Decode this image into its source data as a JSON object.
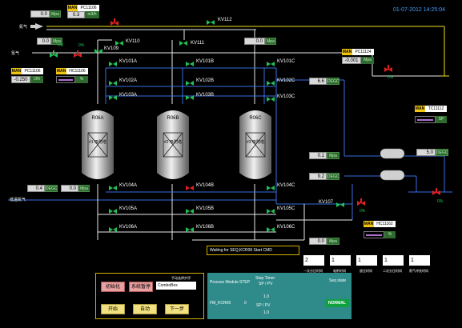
{
  "header": {
    "datetime": "01-07-2012 14:25:04",
    "top_label": "KV112"
  },
  "left_inputs": {
    "n2_label": "氮气",
    "h2_label": "氢气",
    "lowtemp_gas_label": "低温氮气",
    "top_value": "0.0",
    "top_unit": "Mpa",
    "flow_value": "0.0",
    "flow_unit": "Mpa",
    "small_pct": "0%",
    "green_pct": "0%",
    "lowtemp_value": "0.4",
    "lowtemp_unit": "DEGC",
    "lowtemp_value2": "0.0",
    "lowtemp_unit2": "Mpa"
  },
  "pc11106": {
    "mode": "MAN",
    "tag": "PC11106",
    "value": "0.3",
    "unit": "m3/h"
  },
  "hc11106": {
    "mode": "MAN",
    "tag": "PC11106",
    "pv": "-0.250",
    "unit": "ON",
    "tag2": "HC11106",
    "pct": "%"
  },
  "pc11124": {
    "mode": "MAN",
    "tag": "PC11124",
    "pv": "-0.001",
    "unit": "Mpa",
    "pct": "0%"
  },
  "tc11112": {
    "mode": "MAN",
    "tag": "TC11112",
    "sp": "SP"
  },
  "hc11162": {
    "mode": "MAN",
    "tag": "HC11162",
    "pct": "%"
  },
  "valves": {
    "kv110": "KV110",
    "kv109": "KV109",
    "kv111": "KV111",
    "kv101a": "KV101A",
    "kv102a": "KV102A",
    "kv103a": "KV103A",
    "kv101b": "KV101B",
    "kv102b": "KV102B",
    "kv103b": "KV103B",
    "kv101c": "KV101C",
    "kv102c": "KV102C",
    "kv103c": "KV103C",
    "kv104a": "KV104A",
    "kv105a": "KV105A",
    "kv106a": "KV106A",
    "kv104b": "KV104B",
    "kv105b": "KV105B",
    "kv106b": "KV106B",
    "kv104c": "KV104C",
    "kv105c": "KV105C",
    "kv106c": "KV106C",
    "kv107": "KV107"
  },
  "right_values": {
    "top_value": "0.0",
    "top_unit": "Mpa",
    "mid_value": "6.6",
    "mid_unit": "DEGC",
    "p1_value": "0.1",
    "p1_unit": "Mpa",
    "t1_value": "9.2",
    "t1_unit": "DEGC",
    "hx_value": "5.0",
    "hx_unit": "DEGC",
    "bottom_value": "0.0",
    "bottom_unit": "Mpa",
    "pct_a": "0%",
    "pct_b": "0%",
    "pct_c": "0%"
  },
  "reactors": [
    {
      "name": "R06A",
      "label": "#1 吸附塔"
    },
    {
      "name": "R06B",
      "label": "#2 吸附塔"
    },
    {
      "name": "R06C",
      "label": "#3 吸附塔"
    }
  ],
  "message": "Waiting for SEQ,KCR06 Start CMD",
  "control_panel": {
    "title": "手动选择步序",
    "combo": "ComboBox",
    "init_btn": "初始化",
    "pause_btn": "系统暂停",
    "start_btn": "开始",
    "auto_btn": "自动",
    "next_btn": "下一步"
  },
  "status_panel": {
    "col_process": "Process Module",
    "col_step": "STEP",
    "col_timer": "Step Timer",
    "col_timer_sub": "SP / PV",
    "col_seq": "Seq state",
    "module": "FM_KCR06",
    "step": "0",
    "timer_sp": "1.0",
    "sp_pv": "SP / PV",
    "timer_pv": "1.0",
    "seq_state": "NORMAL"
  },
  "timers": [
    {
      "value": "2",
      "label": "一次分压时间"
    },
    {
      "value": "1",
      "label": "吸附时间"
    },
    {
      "value": "1",
      "label": "放压时间"
    },
    {
      "value": "1",
      "label": "二次分压时间"
    },
    {
      "value": "1",
      "label": "氮气冲洗时间"
    }
  ],
  "colors": {
    "background": "#000000",
    "pipe_white": "#e8e8e8",
    "pipe_blue": "#3a6fe0",
    "pipe_yellow": "#f0e020",
    "valve_green": "#22c055",
    "valve_red": "#e02020",
    "status_panel": "#2f8a8a",
    "datetime": "#4a9cff"
  }
}
